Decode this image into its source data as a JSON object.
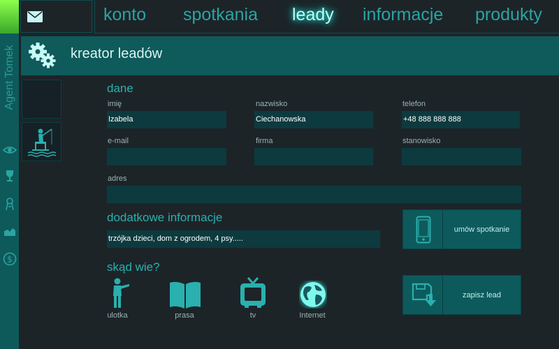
{
  "nav": {
    "items": [
      {
        "label": "konto",
        "active": false
      },
      {
        "label": "spotkania",
        "active": false
      },
      {
        "label": "leady",
        "active": true
      },
      {
        "label": "informacje",
        "active": false
      },
      {
        "label": "produkty",
        "active": false
      }
    ]
  },
  "sidebar": {
    "agent_label": "Agent Tomek",
    "icons": [
      "eye-icon",
      "trophy-icon",
      "award-icon",
      "hand-icon",
      "dollar-icon"
    ]
  },
  "header": {
    "title": "kreator leadów"
  },
  "form": {
    "section_title": "dane",
    "fields": {
      "first_name": {
        "label": "imię",
        "value": "Izabela"
      },
      "last_name": {
        "label": "nazwisko",
        "value": "Ciechanowska"
      },
      "phone": {
        "label": "telefon",
        "value": "+48 888 888 888"
      },
      "email": {
        "label": "e-mail",
        "value": ""
      },
      "company": {
        "label": "firma",
        "value": ""
      },
      "position": {
        "label": "stanowisko",
        "value": ""
      },
      "address": {
        "label": "adres",
        "value": ""
      }
    },
    "additional": {
      "title": "dodatkowe informacje",
      "value": "trzójka dzieci, dom z ogrodem, 4 psy....."
    },
    "source": {
      "title": "skąd wie?",
      "options": [
        {
          "label": "ulotka",
          "icon": "person-icon"
        },
        {
          "label": "prasa",
          "icon": "book-icon"
        },
        {
          "label": "tv",
          "icon": "tv-icon"
        },
        {
          "label": "Internet",
          "icon": "globe-icon",
          "selected": true
        }
      ]
    }
  },
  "actions": {
    "schedule_label": "umów spotkanie",
    "save_label": "zapisz lead"
  },
  "colors": {
    "accent": "#2aa4a2",
    "glow": "#b8fff8",
    "field_bg": "#0d3a3e",
    "header_bg": "#0f5a5a",
    "corner": "#7af03a"
  }
}
